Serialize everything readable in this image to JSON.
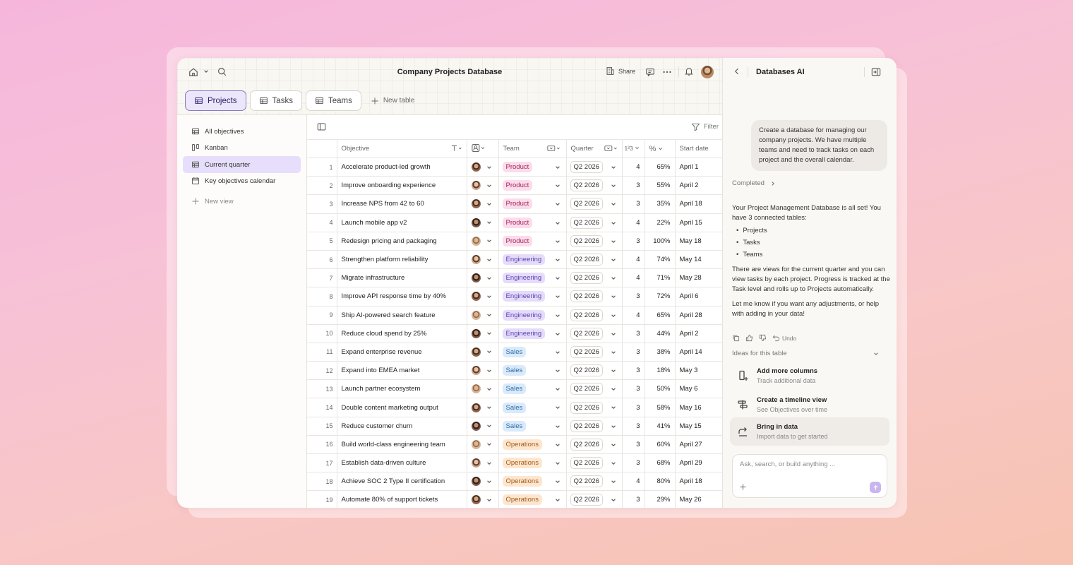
{
  "window": {
    "title": "Company Projects Database"
  },
  "topbar": {
    "share_label": "Share"
  },
  "tabs": [
    {
      "label": "Projects",
      "active": true
    },
    {
      "label": "Tasks",
      "active": false
    },
    {
      "label": "Teams",
      "active": false
    }
  ],
  "new_table_label": "New table",
  "sidebar": {
    "items": [
      {
        "label": "All objectives",
        "icon": "table-icon"
      },
      {
        "label": "Kanban",
        "icon": "kanban-icon"
      },
      {
        "label": "Current quarter",
        "icon": "table-icon",
        "active": true
      },
      {
        "label": "Key objectives calendar",
        "icon": "calendar-icon"
      }
    ],
    "new_view_label": "New view"
  },
  "toolbar": {
    "filter_label": "Filter"
  },
  "columns": {
    "objective": "Objective",
    "team": "Team",
    "quarter": "Quarter",
    "priority": "1²3",
    "progress": "%",
    "start_date": "Start date"
  },
  "rows": [
    {
      "n": "1",
      "objective": "Accelerate product-led growth",
      "team": "Product",
      "quarter": "Q2 2026",
      "priority": "4",
      "progress": "65%",
      "start": "April 1"
    },
    {
      "n": "2",
      "objective": "Improve onboarding experience",
      "team": "Product",
      "quarter": "Q2 2026",
      "priority": "3",
      "progress": "55%",
      "start": "April 2"
    },
    {
      "n": "3",
      "objective": "Increase NPS from 42 to 60",
      "team": "Product",
      "quarter": "Q2 2026",
      "priority": "3",
      "progress": "35%",
      "start": "April 18"
    },
    {
      "n": "4",
      "objective": "Launch mobile app v2",
      "team": "Product",
      "quarter": "Q2 2026",
      "priority": "4",
      "progress": "22%",
      "start": "April 15"
    },
    {
      "n": "5",
      "objective": "Redesign pricing and packaging",
      "team": "Product",
      "quarter": "Q2 2026",
      "priority": "3",
      "progress": "100%",
      "start": "May 18"
    },
    {
      "n": "6",
      "objective": "Strengthen platform reliability",
      "team": "Engineering",
      "quarter": "Q2 2026",
      "priority": "4",
      "progress": "74%",
      "start": "May 14"
    },
    {
      "n": "7",
      "objective": "Migrate infrastructure",
      "team": "Engineering",
      "quarter": "Q2 2026",
      "priority": "4",
      "progress": "71%",
      "start": "May 28"
    },
    {
      "n": "8",
      "objective": "Improve API response time by 40%",
      "team": "Engineering",
      "quarter": "Q2 2026",
      "priority": "3",
      "progress": "72%",
      "start": "April 6"
    },
    {
      "n": "9",
      "objective": "Ship AI-powered search feature",
      "team": "Engineering",
      "quarter": "Q2 2026",
      "priority": "4",
      "progress": "65%",
      "start": "April 28"
    },
    {
      "n": "10",
      "objective": "Reduce cloud spend by 25%",
      "team": "Engineering",
      "quarter": "Q2 2026",
      "priority": "3",
      "progress": "44%",
      "start": "April 2"
    },
    {
      "n": "11",
      "objective": "Expand enterprise revenue",
      "team": "Sales",
      "quarter": "Q2 2026",
      "priority": "3",
      "progress": "38%",
      "start": "April 14"
    },
    {
      "n": "12",
      "objective": "Expand into EMEA market",
      "team": "Sales",
      "quarter": "Q2 2026",
      "priority": "3",
      "progress": "18%",
      "start": "May 3"
    },
    {
      "n": "13",
      "objective": "Launch partner ecosystem",
      "team": "Sales",
      "quarter": "Q2 2026",
      "priority": "3",
      "progress": "50%",
      "start": "May 6"
    },
    {
      "n": "14",
      "objective": "Double content marketing output",
      "team": "Sales",
      "quarter": "Q2 2026",
      "priority": "3",
      "progress": "58%",
      "start": "May 16"
    },
    {
      "n": "15",
      "objective": "Reduce customer churn",
      "team": "Sales",
      "quarter": "Q2 2026",
      "priority": "3",
      "progress": "41%",
      "start": "May 15"
    },
    {
      "n": "16",
      "objective": "Build world-class engineering team",
      "team": "Operations",
      "quarter": "Q2 2026",
      "priority": "3",
      "progress": "60%",
      "start": "April 27"
    },
    {
      "n": "17",
      "objective": "Establish data-driven culture",
      "team": "Operations",
      "quarter": "Q2 2026",
      "priority": "3",
      "progress": "68%",
      "start": "April 29"
    },
    {
      "n": "18",
      "objective": "Achieve SOC 2 Type II certification",
      "team": "Operations",
      "quarter": "Q2 2026",
      "priority": "4",
      "progress": "80%",
      "start": "April 18"
    },
    {
      "n": "19",
      "objective": "Automate 80% of support tickets",
      "team": "Operations",
      "quarter": "Q2 2026",
      "priority": "3",
      "progress": "29%",
      "start": "May 26"
    }
  ],
  "ai": {
    "title": "Databases AI",
    "user_message": "Create a database for managing our company projects. We have multiple teams and need to track tasks on each project and the overall calendar.",
    "completed_label": "Completed",
    "answer_intro": "Your Project Management Database is all set! You have 3 connected tables:",
    "answer_list": [
      "Projects",
      "Tasks",
      "Teams"
    ],
    "answer_body": "There are views for the current quarter and you can view tasks by each project. Progress is tracked at the Task level and rolls up to Projects automatically.",
    "answer_outro": "Let me know if you want any adjustments, or help with adding in your data!",
    "undo_label": "Undo",
    "ideas_header": "Ideas for this table",
    "ideas": [
      {
        "title": "Add more columns",
        "subtitle": "Track additional data"
      },
      {
        "title": "Create a timeline view",
        "subtitle": "See Objectives over time"
      },
      {
        "title": "Bring in data",
        "subtitle": "Import data to get started"
      }
    ],
    "input_placeholder": "Ask, search, or build anything ..."
  },
  "colors": {
    "accent": "#8a78c9",
    "product": "#fbdcea",
    "engineering": "#e5dcfa",
    "sales": "#d9eafb",
    "operations": "#fde6cf"
  }
}
